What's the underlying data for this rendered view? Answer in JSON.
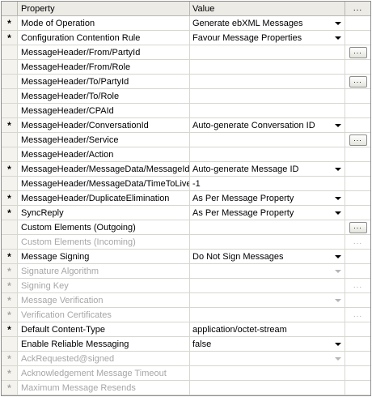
{
  "header": {
    "property": "Property",
    "value": "Value",
    "button": "..."
  },
  "rows": [
    {
      "star": "*",
      "property": "Mode of Operation",
      "value": "Generate ebXML Messages",
      "dropdown": true,
      "button": "",
      "disabled": false
    },
    {
      "star": "*",
      "property": "Configuration Contention Rule",
      "value": "Favour Message Properties",
      "dropdown": true,
      "button": "",
      "disabled": false
    },
    {
      "star": "",
      "property": "MessageHeader/From/PartyId",
      "value": "",
      "dropdown": false,
      "button": "...",
      "disabled": false
    },
    {
      "star": "",
      "property": "MessageHeader/From/Role",
      "value": "",
      "dropdown": false,
      "button": "",
      "disabled": false
    },
    {
      "star": "",
      "property": "MessageHeader/To/PartyId",
      "value": "",
      "dropdown": false,
      "button": "...",
      "disabled": false
    },
    {
      "star": "",
      "property": "MessageHeader/To/Role",
      "value": "",
      "dropdown": false,
      "button": "",
      "disabled": false
    },
    {
      "star": "",
      "property": "MessageHeader/CPAId",
      "value": "",
      "dropdown": false,
      "button": "",
      "disabled": false
    },
    {
      "star": "*",
      "property": "MessageHeader/ConversationId",
      "value": "Auto-generate Conversation ID",
      "dropdown": true,
      "button": "",
      "disabled": false
    },
    {
      "star": "",
      "property": "MessageHeader/Service",
      "value": "",
      "dropdown": false,
      "button": "...",
      "disabled": false
    },
    {
      "star": "",
      "property": "MessageHeader/Action",
      "value": "",
      "dropdown": false,
      "button": "",
      "disabled": false
    },
    {
      "star": "*",
      "property": "MessageHeader/MessageData/MessageId",
      "value": "Auto-generate Message ID",
      "dropdown": true,
      "button": "",
      "disabled": false
    },
    {
      "star": "",
      "property": "MessageHeader/MessageData/TimeToLive",
      "value": "-1",
      "dropdown": false,
      "button": "",
      "disabled": false
    },
    {
      "star": "*",
      "property": "MessageHeader/DuplicateElimination",
      "value": "As Per Message Property",
      "dropdown": true,
      "button": "",
      "disabled": false
    },
    {
      "star": "*",
      "property": "SyncReply",
      "value": "As Per Message Property",
      "dropdown": true,
      "button": "",
      "disabled": false
    },
    {
      "star": "",
      "property": "Custom Elements (Outgoing)",
      "value": "",
      "dropdown": false,
      "button": "...",
      "disabled": false
    },
    {
      "star": "",
      "property": "Custom Elements (Incoming)",
      "value": "",
      "dropdown": false,
      "button": "...",
      "disabled": true
    },
    {
      "star": "*",
      "property": "Message Signing",
      "value": "Do Not Sign Messages",
      "dropdown": true,
      "button": "",
      "disabled": false
    },
    {
      "star": "*",
      "property": "Signature Algorithm",
      "value": "",
      "dropdown": true,
      "button": "",
      "disabled": true
    },
    {
      "star": "*",
      "property": "Signing Key",
      "value": "",
      "dropdown": false,
      "button": "...",
      "disabled": true
    },
    {
      "star": "*",
      "property": "Message Verification",
      "value": "",
      "dropdown": true,
      "button": "",
      "disabled": true
    },
    {
      "star": "*",
      "property": "Verification Certificates",
      "value": "",
      "dropdown": false,
      "button": "...",
      "disabled": true
    },
    {
      "star": "*",
      "property": "Default Content-Type",
      "value": "application/octet-stream",
      "dropdown": false,
      "button": "",
      "disabled": false
    },
    {
      "star": "",
      "property": "Enable Reliable Messaging",
      "value": "false",
      "dropdown": true,
      "button": "",
      "disabled": false
    },
    {
      "star": "*",
      "property": "AckRequested@signed",
      "value": "",
      "dropdown": true,
      "button": "",
      "disabled": true
    },
    {
      "star": "*",
      "property": "Acknowledgement Message Timeout",
      "value": "",
      "dropdown": false,
      "button": "",
      "disabled": true
    },
    {
      "star": "*",
      "property": "Maximum Message Resends",
      "value": "",
      "dropdown": false,
      "button": "",
      "disabled": true
    }
  ]
}
